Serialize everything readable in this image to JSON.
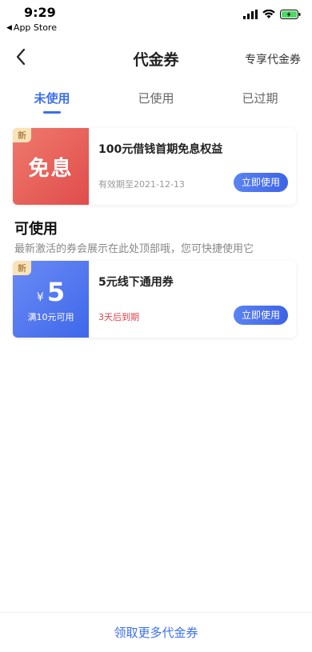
{
  "status_bar": {
    "time": "9:29",
    "back_app": "App Store"
  },
  "nav": {
    "title": "代金券",
    "right_label": "专享代金券"
  },
  "tabs": [
    {
      "label": "未使用",
      "active": true
    },
    {
      "label": "已使用",
      "active": false
    },
    {
      "label": "已过期",
      "active": false
    }
  ],
  "coupons": [
    {
      "badge": "新",
      "left_text": "免息",
      "title": "100元借钱首期免息权益",
      "sub": "有效期至2021-12-13",
      "button": "立即使用"
    },
    {
      "badge": "新",
      "currency": "¥",
      "amount": "5",
      "condition": "满10元可用",
      "title": "5元线下通用券",
      "sub": "3天后到期",
      "button": "立即使用"
    }
  ],
  "section": {
    "title": "可使用",
    "desc": "最新激活的券会展示在此处顶部哦，您可快捷使用它"
  },
  "bottom": {
    "link": "领取更多代金券"
  },
  "colors": {
    "accent": "#3b6ff0",
    "red_card": "#e04c4c",
    "blue_card": "#3f67ea",
    "expire_red": "#e0434a"
  }
}
